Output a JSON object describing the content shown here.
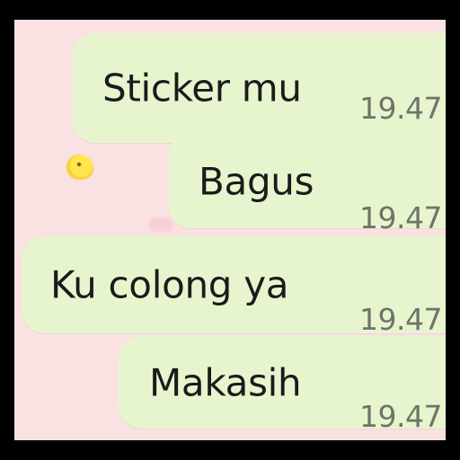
{
  "chat": {
    "background_color": "#fbe2e2",
    "bubble_color": "#e7f5cf",
    "messages": [
      {
        "text": "Sticker mu",
        "time": "19.47"
      },
      {
        "text": "Bagus",
        "time": "19.47"
      },
      {
        "text": "Ku colong ya",
        "time": "19.47"
      },
      {
        "text": "Makasih",
        "time": "19.47"
      }
    ]
  },
  "icons": [
    "duck-sticker-icon",
    "heart-icon"
  ]
}
